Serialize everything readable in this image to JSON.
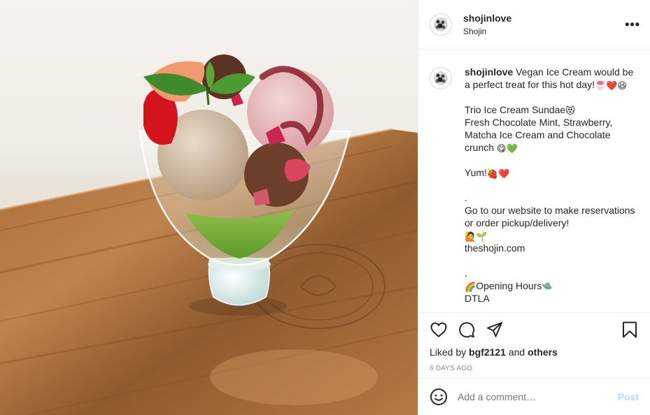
{
  "header": {
    "username": "shojinlove",
    "location": "Shojin",
    "more_icon": "more-horizontal-icon"
  },
  "caption": {
    "username": "shojinlove",
    "lines": [
      "Vegan Ice Cream would be a perfect treat for this hot day!",
      "",
      "Trio Ice Cream Sundae",
      "Fresh Chocolate Mint, Strawberry, Matcha Ice Cream and Chocolate crunch",
      "",
      "Yum!",
      "",
      ".",
      "Go to our website to make reservations or order pickup/delivery!",
      "theshojin.com",
      "",
      ".",
      "Opening Hours",
      "DTLA"
    ],
    "emojis": {
      "line0": "🍧❤️😆",
      "line2": "😻",
      "line3": "😋💚",
      "line5": "🍓❤️",
      "line8": "🙋🌱",
      "line12_pre": "🌈",
      "line12_post": "🛸"
    }
  },
  "actions": {
    "like_icon": "heart-icon",
    "comment_icon": "comment-icon",
    "share_icon": "paper-plane-icon",
    "save_icon": "bookmark-icon"
  },
  "likes": {
    "prefix": "Liked by",
    "user": "bgf2121",
    "and": "and",
    "others": "others"
  },
  "timestamp": "6 DAYS AGO",
  "comment_box": {
    "placeholder": "Add a comment…",
    "post_label": "Post",
    "emoji_icon": "smiley-icon"
  },
  "colors": {
    "post_disabled": "#b3dbff",
    "border": "#efefef",
    "muted": "#8e8e8e"
  }
}
